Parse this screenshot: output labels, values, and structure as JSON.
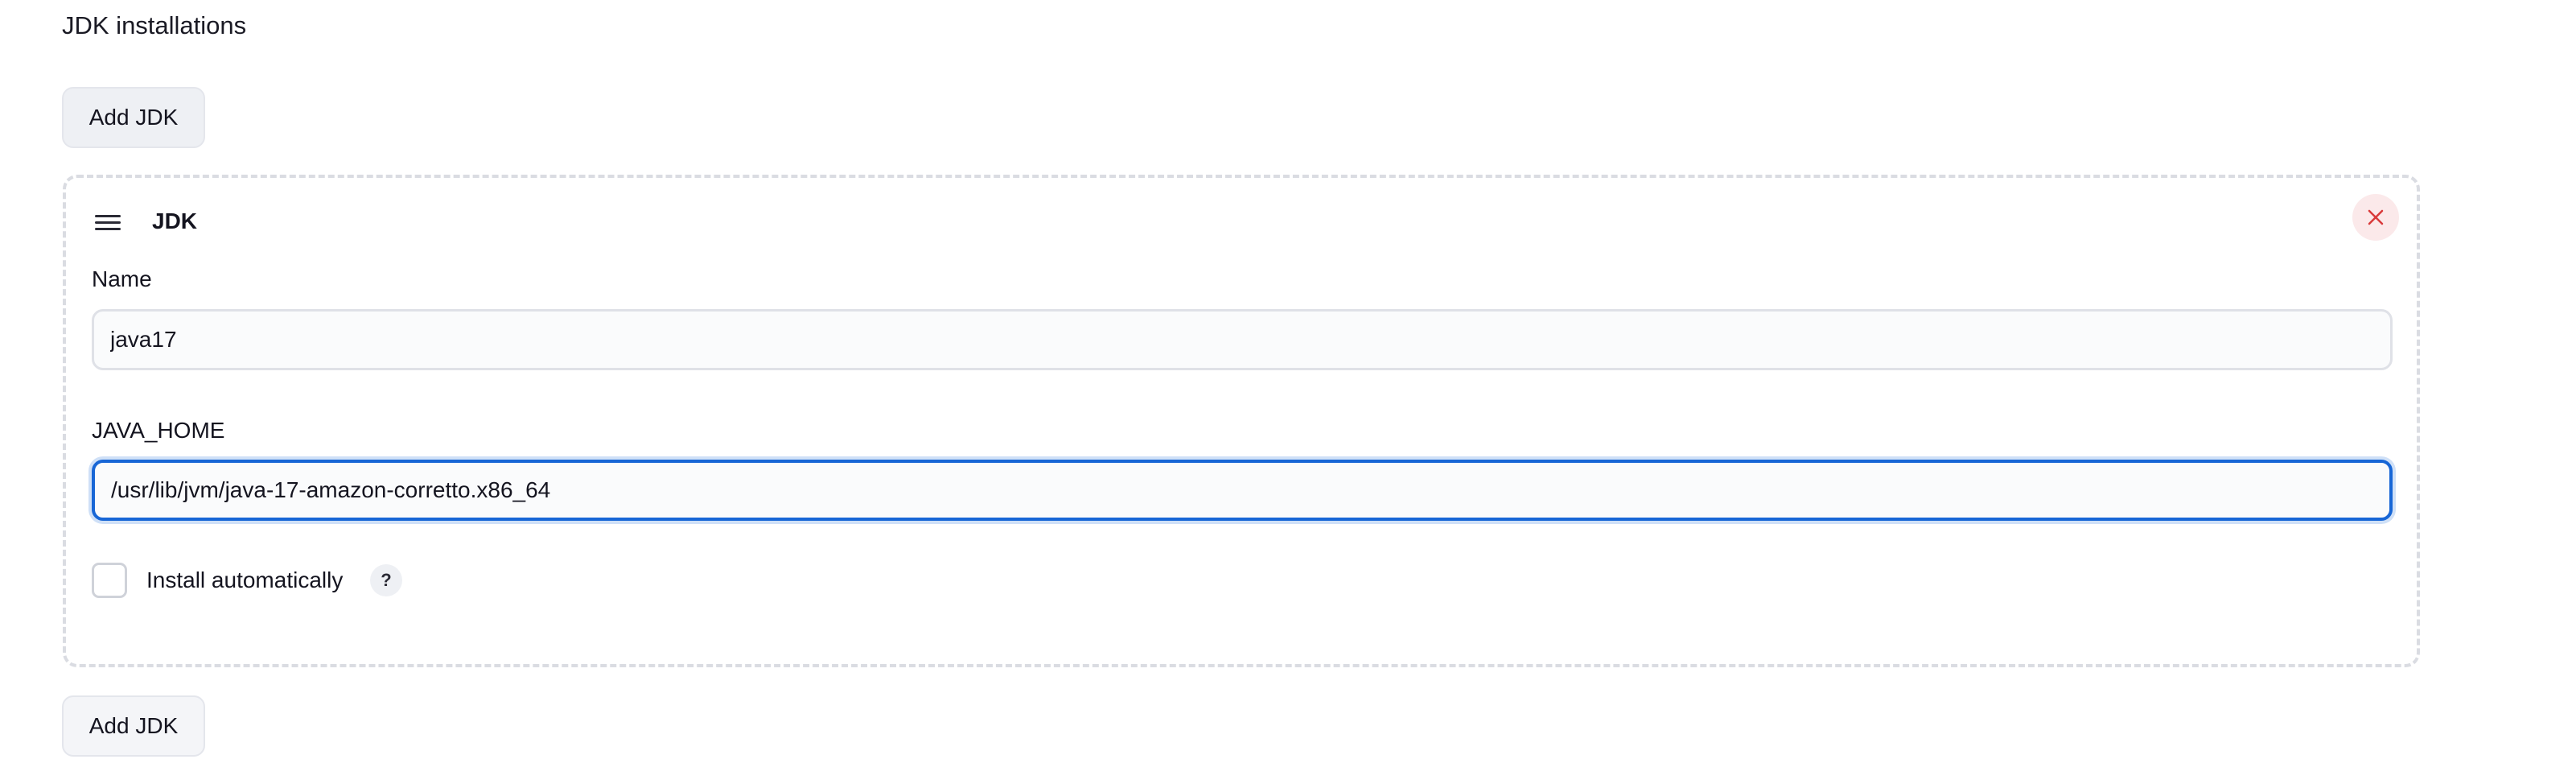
{
  "section": {
    "title": "JDK installations"
  },
  "buttons": {
    "add_top": "Add JDK",
    "add_bottom": "Add JDK"
  },
  "jdk": {
    "header": "JDK",
    "drag_icon": "drag-handle-icon",
    "close_icon": "close-icon",
    "name_label": "Name",
    "name_value": "java17",
    "java_home_label": "JAVA_HOME",
    "java_home_value": "/usr/lib/jvm/java-17-amazon-corretto.x86_64",
    "install_auto_label": "Install automatically",
    "install_auto_checked": false,
    "help_text": "?"
  },
  "colors": {
    "focus_border": "#1766d6",
    "close_icon": "#d93a3a",
    "close_bg": "#fbe9ea"
  }
}
